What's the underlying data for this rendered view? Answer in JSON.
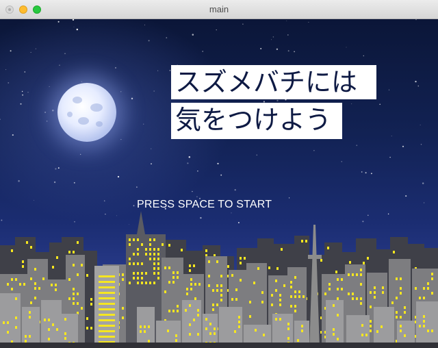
{
  "window": {
    "title": "main"
  },
  "game": {
    "title_line1": "スズメバチには",
    "title_line2": "気をつけよう",
    "prompt": "PRESS SPACE TO START"
  },
  "colors": {
    "sky_top": "#0b1638",
    "sky_bottom": "#2e3f90",
    "window_light": "#f5e620",
    "building_front": "#9a9a9a",
    "building_back": "#555555"
  }
}
